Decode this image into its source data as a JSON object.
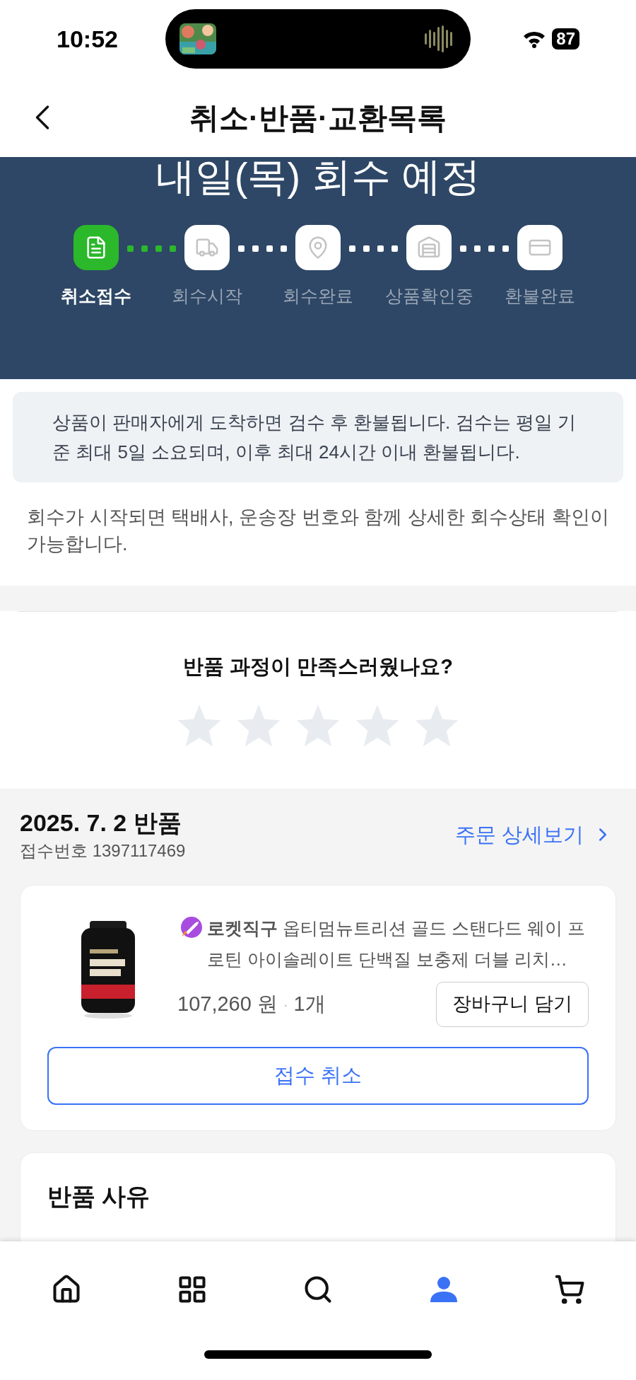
{
  "status_bar": {
    "time": "10:52",
    "battery": "87"
  },
  "header": {
    "title": "취소·반품·교환목록"
  },
  "banner": {
    "title": "내일(목) 회수 예정",
    "steps": [
      {
        "kind": "receipt",
        "label": "취소접수",
        "selected": true
      },
      {
        "kind": "truck",
        "label": "회수시작",
        "selected": false
      },
      {
        "kind": "pin",
        "label": "회수완료",
        "selected": false
      },
      {
        "kind": "warehouse",
        "label": "상품확인중",
        "selected": false
      },
      {
        "kind": "card",
        "label": "환불완료",
        "selected": false
      }
    ]
  },
  "notice": "상품이 판매자에게 도착하면 검수 후 환불됩니다. 검수는 평일 기준 최대 5일 소요되며, 이후 최대 24시간 이내 환불됩니다.",
  "info": "회수가 시작되면 택배사, 운송장 번호와 함께 상세한 회수상태 확인이 가능합니다.",
  "rating": {
    "question": "반품 과정이 만족스러웠나요?",
    "stars": 0
  },
  "order": {
    "date": "2025. 7. 2 반품",
    "receipt": "접수번호 1397117469",
    "detail_link": "주문 상세보기",
    "product": {
      "title": "**로켓직구** 옵티멈뉴트리션 골드 스탠다드 웨이 프로틴 아이솔레이트 단백질 보충제 더블 리치…",
      "price": "107,260 원",
      "separator": "·",
      "quantity": "1개",
      "cart_button": "장바구니 담기"
    },
    "cancel_button": "접수 취소"
  },
  "reason": {
    "title": "반품 사유"
  },
  "nav": [
    {
      "kind": "home",
      "selected": false
    },
    {
      "kind": "grid",
      "selected": false
    },
    {
      "kind": "search",
      "selected": false
    },
    {
      "kind": "user",
      "selected": true
    },
    {
      "kind": "cart",
      "selected": false
    }
  ]
}
